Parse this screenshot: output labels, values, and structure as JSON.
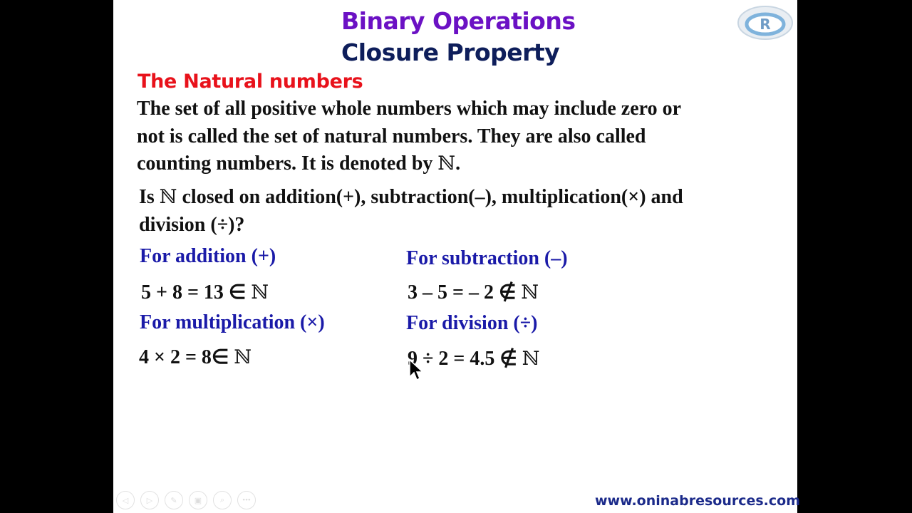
{
  "slide": {
    "title_line1": "Binary Operations",
    "title_line2": "Closure Property",
    "section_heading": "The Natural numbers",
    "definition": {
      "line1": "The set of all positive whole numbers which may include zero or",
      "line2": "not is called the set of natural numbers. They are also called",
      "line3_pre": "counting numbers. It is denoted by ",
      "symbol": "ℕ",
      "line3_post": "."
    },
    "question": {
      "pre": "Is ",
      "symbol": "ℕ",
      "post1": " closed on addition(+), subtraction(–), multiplication(×) and",
      "line2": "division (÷)?"
    },
    "examples": [
      {
        "heading": "For addition (+)",
        "expr": "5 + 8 = 13 ∈ ",
        "symbol": "ℕ"
      },
      {
        "heading": "For subtraction (–)",
        "expr": "3 – 5 = – 2 ∉ ",
        "symbol": "ℕ"
      },
      {
        "heading": "For multiplication (×)",
        "expr": "4 × 2 = 8∈ ",
        "symbol": "ℕ"
      },
      {
        "heading": "For division (÷)",
        "expr": "9 ÷ 2 = 4.5 ∉ ",
        "symbol": "ℕ"
      }
    ],
    "logo_icon": "oninab-resources-logo",
    "website": "www.oninabresources.com",
    "colors": {
      "title1": "#6b11c4",
      "title2": "#0e1e5b",
      "section": "#e8121b",
      "example_heading": "#1a1aa8",
      "website": "#1b2a8a"
    }
  },
  "controls": {
    "prev": "◁",
    "next": "▷",
    "pen": "✎",
    "slides": "▣",
    "zoom": "⌕",
    "more": "•••"
  }
}
